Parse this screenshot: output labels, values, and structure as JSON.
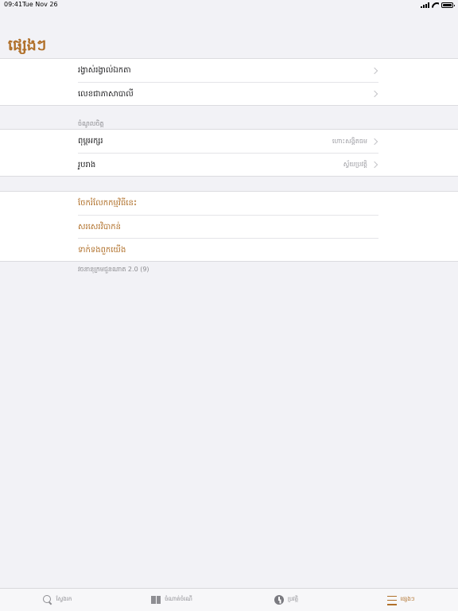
{
  "status_bar": {
    "time": "09:41",
    "date": "Tue Nov 26"
  },
  "page": {
    "title": "ផ្សេងៗ"
  },
  "group1": {
    "items": [
      {
        "label": "រង្វាស់រង្វាល់ឯកតា"
      },
      {
        "label": "លេខជាភាសាបាលី"
      }
    ]
  },
  "settings": {
    "header": "ចំណូលចិត្ត",
    "items": [
      {
        "label": "ពុម្ពអក្សរ",
        "value": "ហោះសង្គិតធម"
      },
      {
        "label": "រូបរាង",
        "value": "ស្វ័យប្រវត្តិ"
      }
    ]
  },
  "links": {
    "items": [
      {
        "label": "ចែករំលែកកម្មវិធីនេះ"
      },
      {
        "label": "សរសេរវិបាកន់"
      },
      {
        "label": "ទាក់ទងពួកយើង"
      }
    ]
  },
  "footer": {
    "version": "វចនានុក្រមជួនណាត 2.0 (9)"
  },
  "tabs": [
    {
      "label": "ស្វែងរក",
      "icon": "search-icon",
      "active": false
    },
    {
      "label": "ចំណាត់ចំណើ",
      "icon": "book-icon",
      "active": false
    },
    {
      "label": "ប្រវត្តិ",
      "icon": "clock-icon",
      "active": false
    },
    {
      "label": "ផ្សេងៗ",
      "icon": "menu-icon",
      "active": true
    }
  ],
  "colors": {
    "accent": "#b0702a",
    "background": "#f2f2f6"
  }
}
